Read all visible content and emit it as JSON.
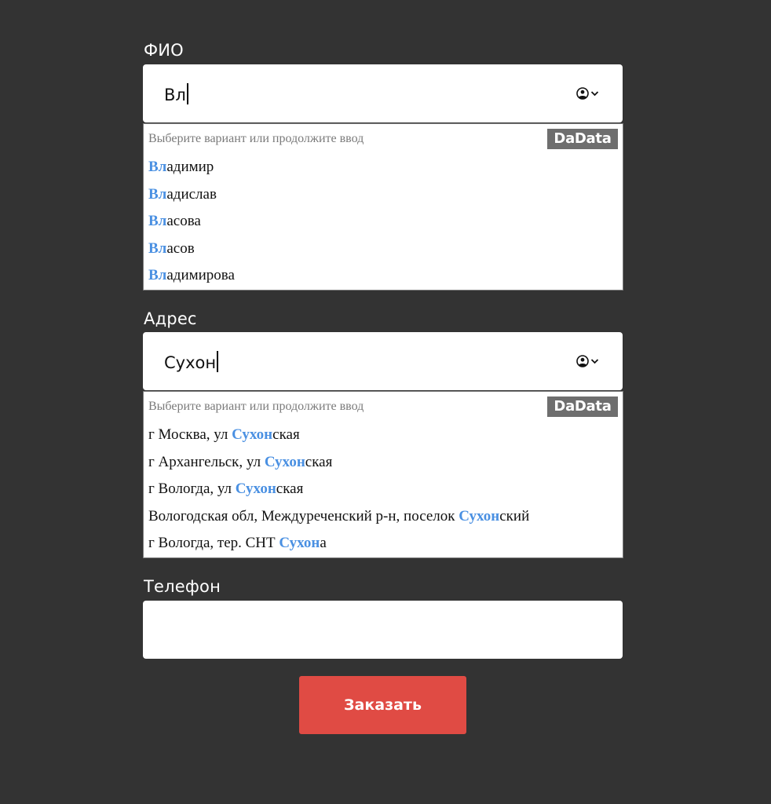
{
  "fio": {
    "label": "ФИО",
    "value": "Вл",
    "icon": "person-circle-icon",
    "suggestions": {
      "hint": "Выберите вариант или продолжите ввод",
      "logo": "DaData",
      "items": [
        {
          "match": "Вл",
          "rest_before": "",
          "rest_after": "адимир"
        },
        {
          "match": "Вл",
          "rest_before": "",
          "rest_after": "адислав"
        },
        {
          "match": "Вл",
          "rest_before": "",
          "rest_after": "асова"
        },
        {
          "match": "Вл",
          "rest_before": "",
          "rest_after": "асов"
        },
        {
          "match": "Вл",
          "rest_before": "",
          "rest_after": "адимирова"
        }
      ]
    }
  },
  "address": {
    "label": "Адрес",
    "value": "Сухон",
    "icon": "person-circle-icon",
    "suggestions": {
      "hint": "Выберите вариант или продолжите ввод",
      "logo": "DaData",
      "items": [
        {
          "rest_before": "г Москва, ул ",
          "match": "Сухон",
          "rest_after": "ская"
        },
        {
          "rest_before": "г Архангельск, ул ",
          "match": "Сухон",
          "rest_after": "ская"
        },
        {
          "rest_before": "г Вологда, ул ",
          "match": "Сухон",
          "rest_after": "ская"
        },
        {
          "rest_before": "Вологодская обл, Междуреченский р-н, поселок ",
          "match": "Сухон",
          "rest_after": "ский"
        },
        {
          "rest_before": "г Вологда, тер. СНТ ",
          "match": "Сухон",
          "rest_after": "а"
        }
      ]
    }
  },
  "phone": {
    "label": "Телефон",
    "value": ""
  },
  "submit": {
    "label": "Заказать"
  },
  "colors": {
    "background": "#333333",
    "highlight": "#4a90e2",
    "button": "#e04b44",
    "logo_bg": "#6e6e6e"
  }
}
